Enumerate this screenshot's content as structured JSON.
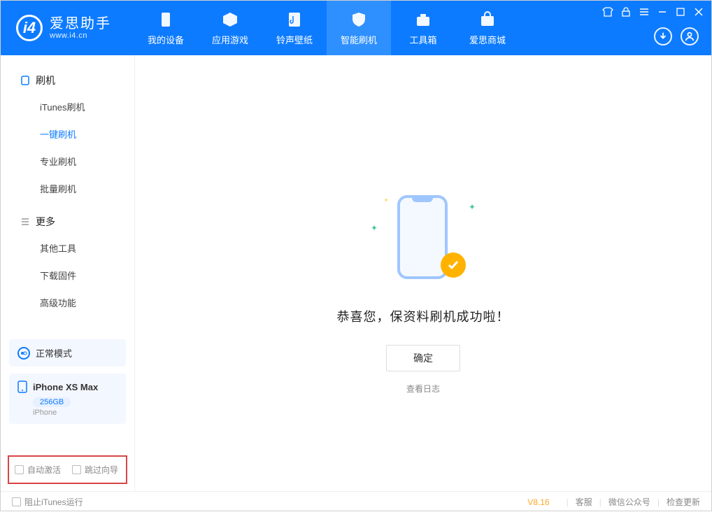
{
  "header": {
    "logo_title": "爱思助手",
    "logo_sub": "www.i4.cn",
    "nav": [
      {
        "label": "我的设备",
        "icon": "device"
      },
      {
        "label": "应用游戏",
        "icon": "cube"
      },
      {
        "label": "铃声壁纸",
        "icon": "music"
      },
      {
        "label": "智能刷机",
        "icon": "shield",
        "active": true
      },
      {
        "label": "工具箱",
        "icon": "toolbox"
      },
      {
        "label": "爱思商城",
        "icon": "cart"
      }
    ]
  },
  "sidebar": {
    "sections": [
      {
        "head": "刷机",
        "icon": "phone",
        "items": [
          "iTunes刷机",
          "一键刷机",
          "专业刷机",
          "批量刷机"
        ],
        "active_index": 1
      },
      {
        "head": "更多",
        "icon": "list",
        "items": [
          "其他工具",
          "下载固件",
          "高级功能"
        ],
        "active_index": -1
      }
    ],
    "mode_label": "正常模式",
    "device_name": "iPhone XS Max",
    "device_capacity": "256GB",
    "device_type": "iPhone",
    "chk_auto_activate": "自动激活",
    "chk_skip_guide": "跳过向导"
  },
  "main": {
    "success_text": "恭喜您，保资料刷机成功啦！",
    "ok_button": "确定",
    "log_link": "查看日志"
  },
  "footer": {
    "block_itunes": "阻止iTunes运行",
    "version": "V8.16",
    "links": [
      "客服",
      "微信公众号",
      "检查更新"
    ]
  }
}
